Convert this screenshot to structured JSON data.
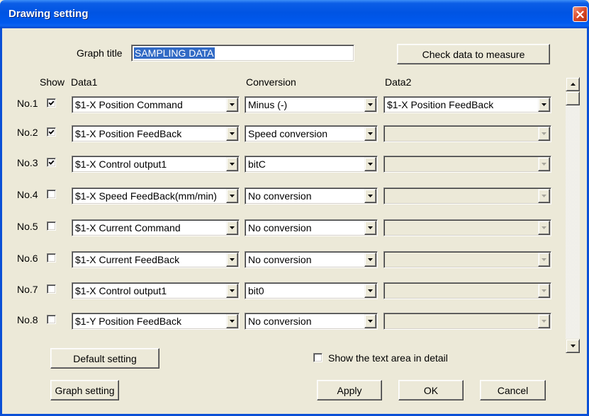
{
  "window": {
    "title": "Drawing setting"
  },
  "graph_title": {
    "label": "Graph title",
    "value": "SAMPLING DATA"
  },
  "buttons": {
    "check_data": "Check data to measure",
    "default_setting": "Default setting",
    "graph_setting": "Graph setting",
    "apply": "Apply",
    "ok": "OK",
    "cancel": "Cancel"
  },
  "headers": {
    "show": "Show",
    "data1": "Data1",
    "conversion": "Conversion",
    "data2": "Data2"
  },
  "rows": [
    {
      "label": "No.1",
      "show": true,
      "data1": "$1-X Position Command",
      "conversion": "Minus (-)",
      "data2": "$1-X Position FeedBack",
      "data2_enabled": true
    },
    {
      "label": "No.2",
      "show": true,
      "data1": "$1-X Position FeedBack",
      "conversion": "Speed conversion",
      "data2": "",
      "data2_enabled": false
    },
    {
      "label": "No.3",
      "show": true,
      "data1": "$1-X Control output1",
      "conversion": "bitC",
      "data2": "",
      "data2_enabled": false
    },
    {
      "label": "No.4",
      "show": false,
      "data1": "$1-X Speed FeedBack(mm/min)",
      "conversion": "No conversion",
      "data2": "",
      "data2_enabled": false
    },
    {
      "label": "No.5",
      "show": false,
      "data1": "$1-X Current Command",
      "conversion": "No conversion",
      "data2": "",
      "data2_enabled": false
    },
    {
      "label": "No.6",
      "show": false,
      "data1": "$1-X Current FeedBack",
      "conversion": "No conversion",
      "data2": "",
      "data2_enabled": false
    },
    {
      "label": "No.7",
      "show": false,
      "data1": "$1-X Control output1",
      "conversion": "bit0",
      "data2": "",
      "data2_enabled": false
    },
    {
      "label": "No.8",
      "show": false,
      "data1": "$1-Y Position FeedBack",
      "conversion": "No conversion",
      "data2": "",
      "data2_enabled": false
    }
  ],
  "detail_option": {
    "label": "Show the text area in detail",
    "checked": false
  },
  "scrollbar": {
    "position": 0
  },
  "icons": {
    "close": "close-icon",
    "checkbox_check": "check-icon",
    "dropdown": "chevron-down-icon",
    "scroll_up": "arrow-up-icon",
    "scroll_down": "arrow-down-icon"
  },
  "colors": {
    "title_bar": "#0054E3",
    "window_frame": "#0A4FD6",
    "close_button": "#D9482A",
    "dialog_background": "#ECE9D8",
    "selection_highlight": "#316AC5"
  }
}
